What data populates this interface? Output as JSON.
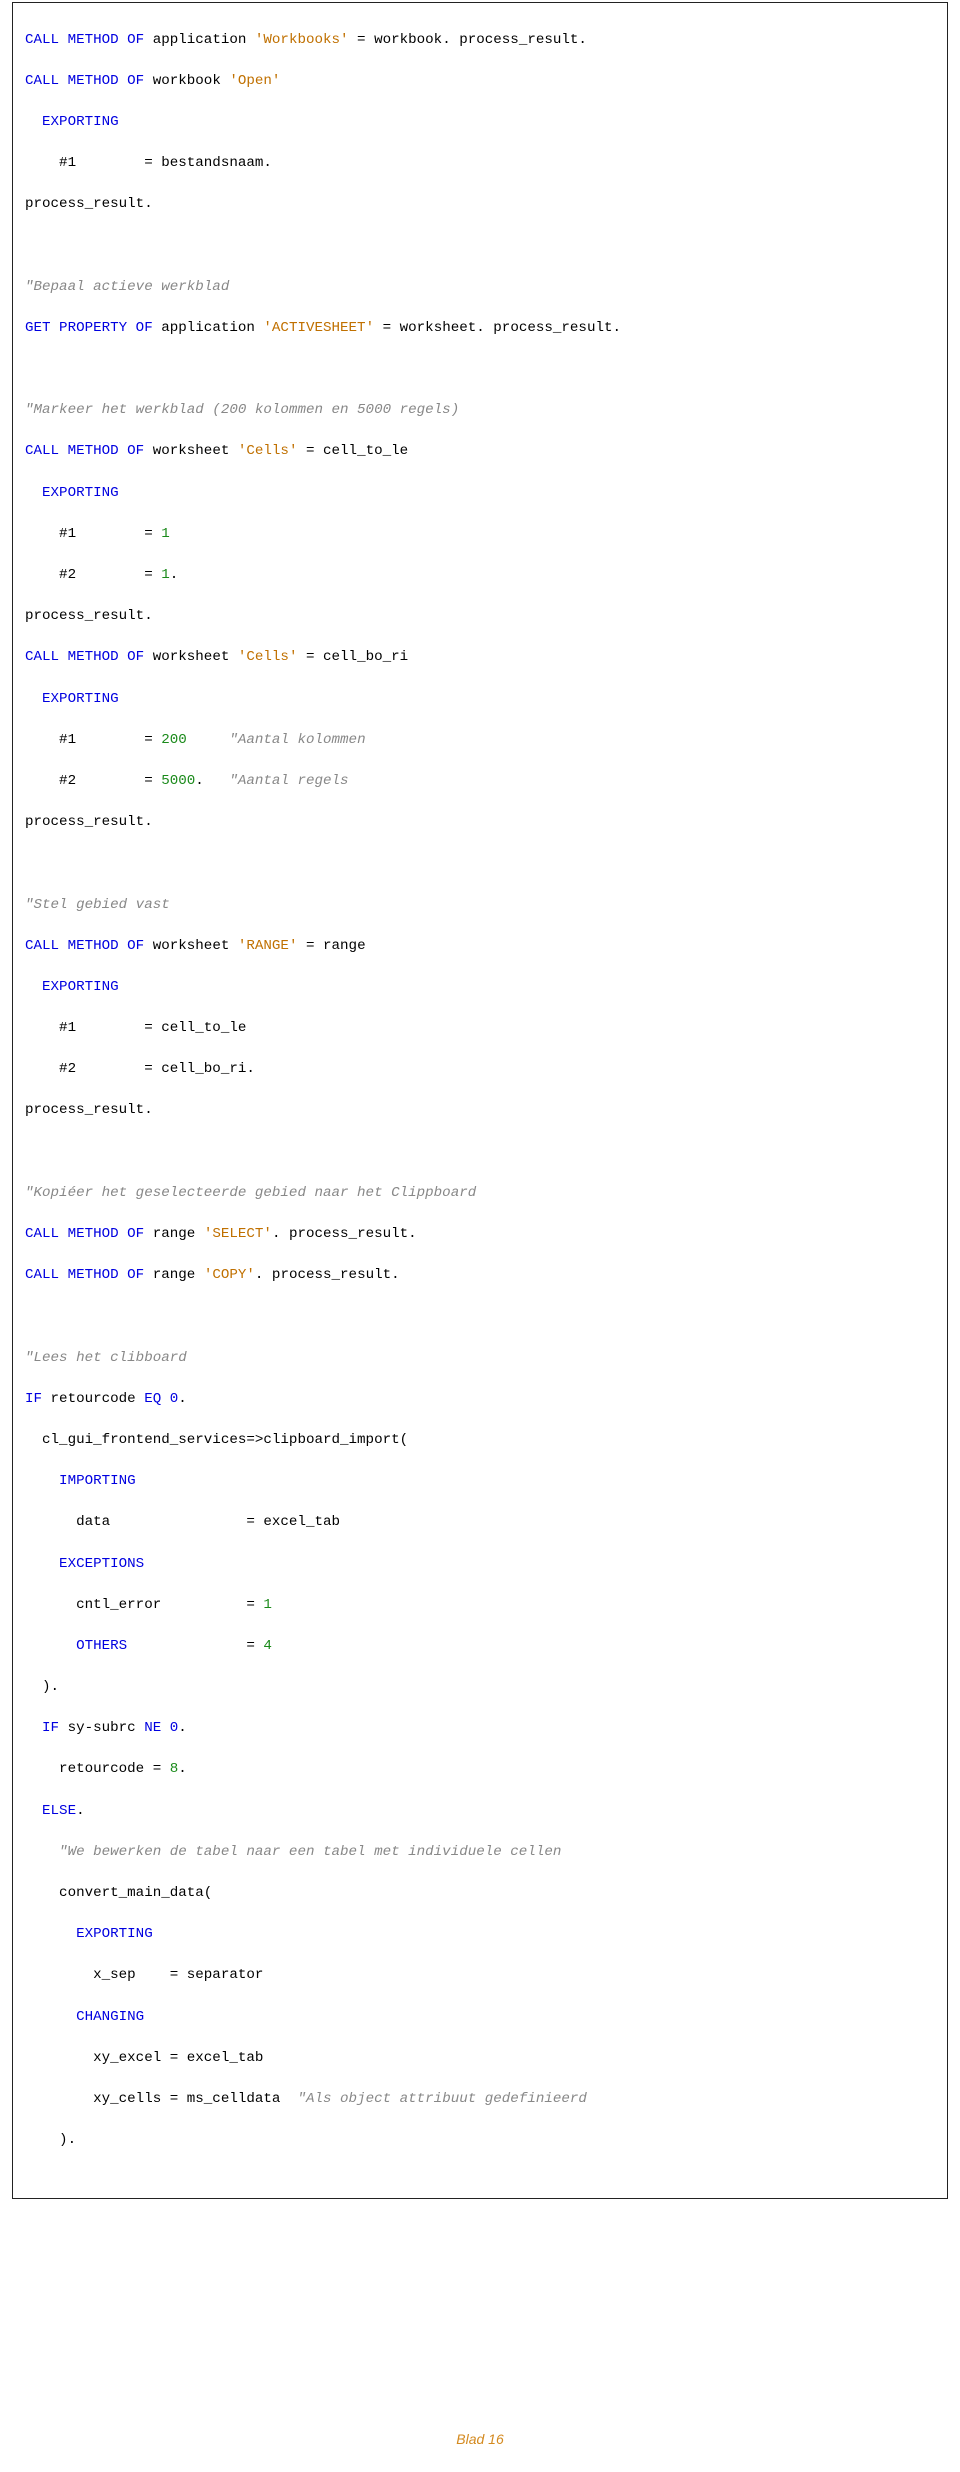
{
  "code": {
    "l1a": "CALL METHOD OF",
    "l1b": " application ",
    "l1c": "'Workbooks'",
    "l1d": " = workbook. process_result.",
    "l2a": "CALL METHOD OF",
    "l2b": " workbook ",
    "l2c": "'Open'",
    "l3": "  EXPORTING",
    "l4a": "    #1        = bestandsnaam.",
    "l5": "process_result.",
    "blank": "",
    "l7": "\"Bepaal actieve werkblad",
    "l8a": "GET PROPERTY OF",
    "l8b": " application ",
    "l8c": "'ACTIVESHEET'",
    "l8d": " = worksheet. process_result.",
    "l10": "\"Markeer het werkblad (200 kolommen en 5000 regels)",
    "l11a": "CALL METHOD OF",
    "l11b": " worksheet ",
    "l11c": "'Cells'",
    "l11d": " = cell_to_le",
    "l12": "  EXPORTING",
    "l13a": "    #1        = ",
    "l13b": "1",
    "l14a": "    #2        = ",
    "l14b": "1",
    "l14c": ".",
    "l15": "process_result.",
    "l16a": "CALL METHOD OF",
    "l16b": " worksheet ",
    "l16c": "'Cells'",
    "l16d": " = cell_bo_ri",
    "l17": "  EXPORTING",
    "l18a": "    #1        = ",
    "l18b": "200",
    "l18c": "     ",
    "l18d": "\"Aantal kolommen",
    "l19a": "    #2        = ",
    "l19b": "5000",
    "l19c": ".   ",
    "l19d": "\"Aantal regels",
    "l20": "process_result.",
    "l22": "\"Stel gebied vast",
    "l23a": "CALL METHOD OF",
    "l23b": " worksheet ",
    "l23c": "'RANGE'",
    "l23d": " = range",
    "l24": "  EXPORTING",
    "l25": "    #1        = cell_to_le",
    "l26": "    #2        = cell_bo_ri.",
    "l27": "process_result.",
    "l29": "\"Kopiéer het geselecteerde gebied naar het Clippboard",
    "l30a": "CALL METHOD OF",
    "l30b": " range ",
    "l30c": "'SELECT'",
    "l30d": ". process_result.",
    "l31a": "CALL METHOD OF",
    "l31b": " range ",
    "l31c": "'COPY'",
    "l31d": ". process_result.",
    "l33": "\"Lees het clibboard",
    "l34a": "IF",
    "l34b": " retourcode ",
    "l34c": "EQ 0",
    "l34d": ".",
    "l35": "  cl_gui_frontend_services=>clipboard_import(",
    "l36": "    IMPORTING",
    "l37": "      data                = excel_tab",
    "l38": "    EXCEPTIONS",
    "l39a": "      cntl_error          = ",
    "l39b": "1",
    "l40a": "      ",
    "l40b": "OTHERS",
    "l40c": "              = ",
    "l40d": "4",
    "l41": "  ).",
    "l42a": "  ",
    "l42b": "IF",
    "l42c": " sy-subrc ",
    "l42d": "NE 0",
    "l42e": ".",
    "l43a": "    retourcode = ",
    "l43b": "8",
    "l43c": ".",
    "l44a": "  ",
    "l44b": "ELSE",
    "l44c": ".",
    "l45": "    \"We bewerken de tabel naar een tabel met individuele cellen",
    "l46": "    convert_main_data(",
    "l47": "      EXPORTING",
    "l48": "        x_sep    = separator",
    "l49": "      CHANGING",
    "l50": "        xy_excel = excel_tab",
    "l51a": "        xy_cells = ms_celldata  ",
    "l51b": "\"Als object attribuut gedefinieerd",
    "l52": "    )."
  },
  "footer": "Blad 16"
}
